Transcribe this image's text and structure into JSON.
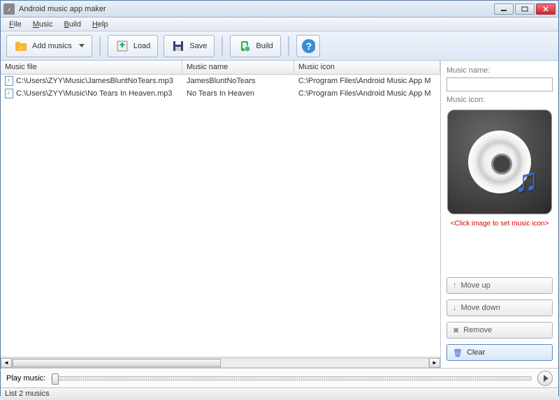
{
  "window": {
    "title": "Android music app maker"
  },
  "menu": {
    "file": "File",
    "music": "Music",
    "build": "Build",
    "help": "Help"
  },
  "toolbar": {
    "add_musics": "Add musics",
    "load": "Load",
    "save": "Save",
    "build": "Build"
  },
  "table": {
    "headers": {
      "file": "Music file",
      "name": "Music name",
      "icon": "Music icon"
    },
    "rows": [
      {
        "file": "C:\\Users\\ZYY\\Music\\JamesBluntNoTears.mp3",
        "name": "JamesBluntNoTears",
        "icon": "C:\\Program Files\\Android Music App M"
      },
      {
        "file": "C:\\Users\\ZYY\\Music\\No Tears In Heaven.mp3",
        "name": "No Tears In Heaven",
        "icon": "C:\\Program Files\\Android Music App M"
      }
    ]
  },
  "side": {
    "music_name_label": "Music name:",
    "music_name_value": "",
    "music_icon_label": "Music icon:",
    "hint": "<Click image to set music icon>",
    "move_up": "Move up",
    "move_down": "Move down",
    "remove": "Remove",
    "clear": "Clear"
  },
  "playbar": {
    "label": "Play music:"
  },
  "status": {
    "text": "List 2 musics"
  }
}
